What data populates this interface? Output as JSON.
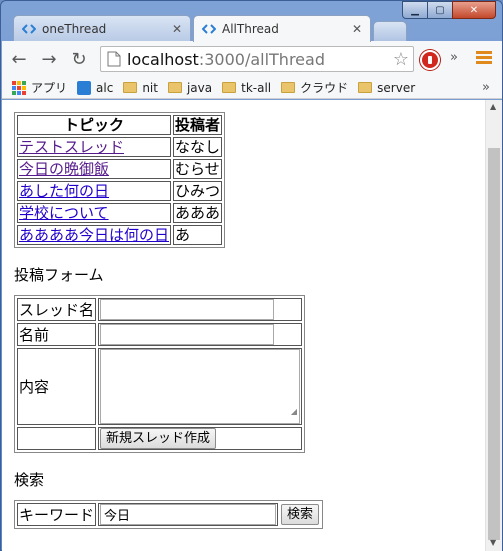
{
  "browser": {
    "tabs": [
      {
        "title": "oneThread",
        "active": false
      },
      {
        "title": "AllThread",
        "active": true
      }
    ],
    "url_host": "localhost",
    "url_rest": ":3000/allThread",
    "bookmarks": [
      {
        "label": "アプリ",
        "icon": "apps-icon"
      },
      {
        "label": "alc",
        "icon": "alc-icon"
      },
      {
        "label": "nit",
        "icon": "folder-icon"
      },
      {
        "label": "java",
        "icon": "folder-icon"
      },
      {
        "label": "tk-all",
        "icon": "folder-icon"
      },
      {
        "label": "クラウド",
        "icon": "folder-icon"
      },
      {
        "label": "server",
        "icon": "folder-icon"
      }
    ],
    "more_glyph": "»"
  },
  "threads": {
    "headers": {
      "topic": "トピック",
      "author": "投稿者"
    },
    "rows": [
      {
        "topic": "テストスレッド",
        "author": "ななし",
        "visited": true
      },
      {
        "topic": "今日の晩御飯",
        "author": "むらせ",
        "visited": true
      },
      {
        "topic": "あした何の日",
        "author": "ひみつ",
        "visited": false
      },
      {
        "topic": "学校について",
        "author": "あああ",
        "visited": false
      },
      {
        "topic": "ああああ今日は何の日",
        "author": "あ",
        "visited": false
      }
    ]
  },
  "post_form": {
    "title": "投稿フォーム",
    "thread_name_label": "スレッド名",
    "thread_name_value": "",
    "name_label": "名前",
    "name_value": "",
    "content_label": "内容",
    "submit_label": "新規スレッド作成"
  },
  "search": {
    "title": "検索",
    "keyword_label": "キーワード",
    "keyword_value": "今日",
    "submit_label": "検索"
  }
}
